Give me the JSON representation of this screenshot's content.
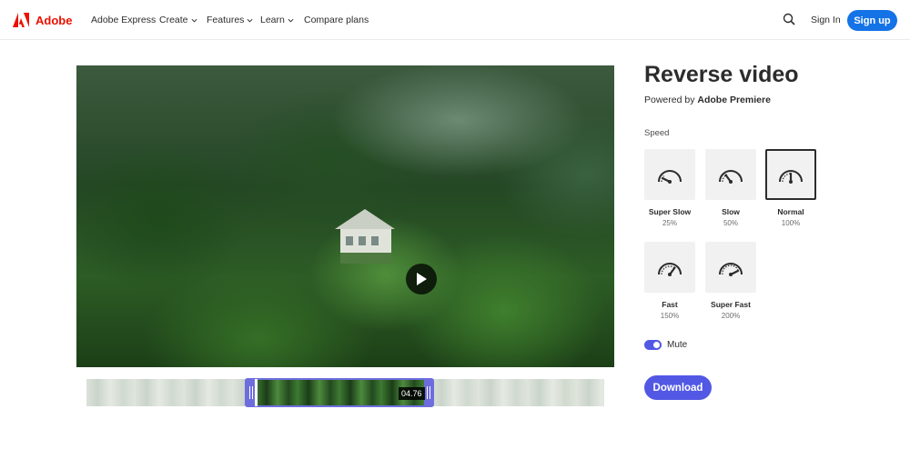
{
  "nav": {
    "brand": "Adobe",
    "items": [
      {
        "label": "Adobe Express",
        "dropdown": false
      },
      {
        "label": "Create",
        "dropdown": true
      },
      {
        "label": "Features",
        "dropdown": true
      },
      {
        "label": "Learn",
        "dropdown": true
      },
      {
        "label": "Compare plans",
        "dropdown": false
      }
    ],
    "sign_in": "Sign In",
    "sign_up": "Sign up"
  },
  "video": {
    "play_icon": "play-icon",
    "timecode": "04.76"
  },
  "panel": {
    "title": "Reverse video",
    "powered_prefix": "Powered by",
    "powered_product": "Adobe Premiere",
    "speed_label": "Speed",
    "speeds": [
      {
        "name": "Super Slow",
        "percent": "25%",
        "selected": false
      },
      {
        "name": "Slow",
        "percent": "50%",
        "selected": false
      },
      {
        "name": "Normal",
        "percent": "100%",
        "selected": true
      },
      {
        "name": "Fast",
        "percent": "150%",
        "selected": false
      },
      {
        "name": "Super Fast",
        "percent": "200%",
        "selected": false
      }
    ],
    "mute_label": "Mute",
    "mute_on": true,
    "download_label": "Download"
  },
  "colors": {
    "accent": "#5258e4",
    "brand_red": "#eb1000",
    "signup_blue": "#1473e6"
  }
}
